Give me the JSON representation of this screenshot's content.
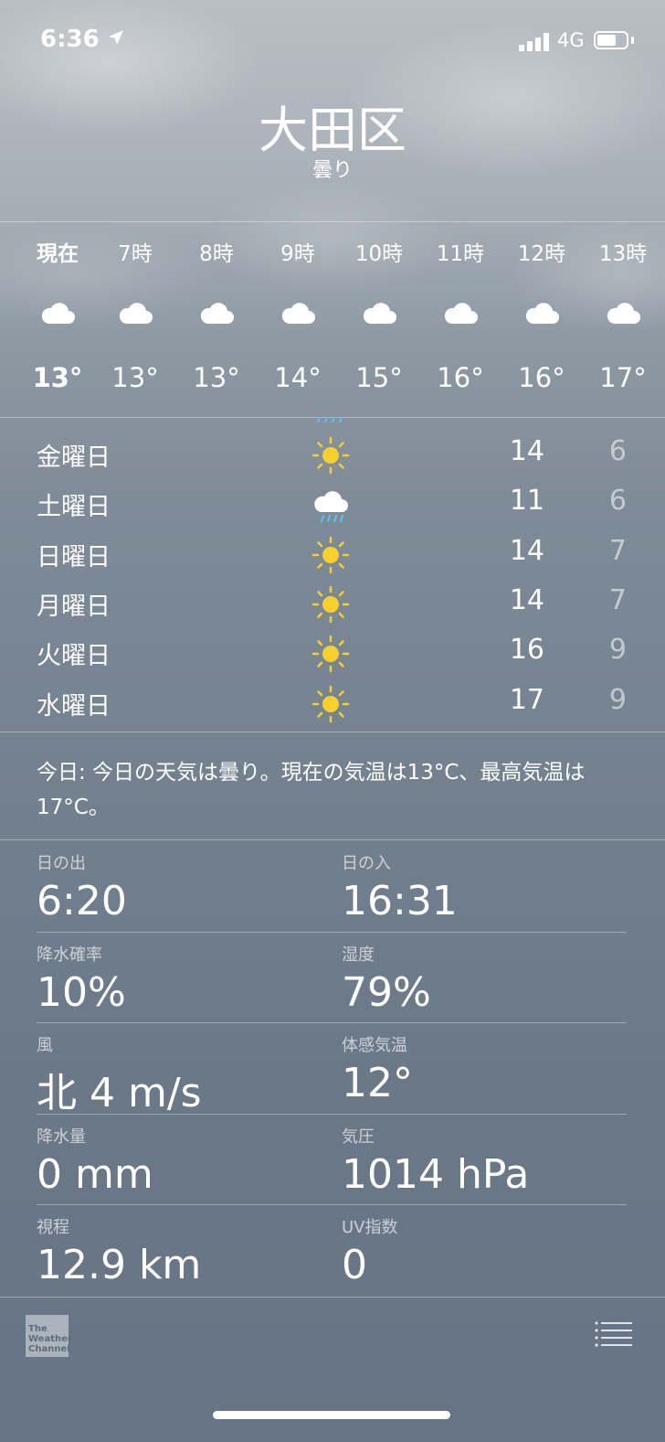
{
  "status_bar": {
    "time": "6:36",
    "network": "4G"
  },
  "location": {
    "city": "大田区",
    "condition": "曇り"
  },
  "hourly": [
    {
      "label": "現在",
      "temp": "13°",
      "icon": "cloud-icon"
    },
    {
      "label": "7時",
      "temp": "13°",
      "icon": "cloud-icon"
    },
    {
      "label": "8時",
      "temp": "13°",
      "icon": "cloud-icon"
    },
    {
      "label": "9時",
      "temp": "14°",
      "icon": "cloud-icon"
    },
    {
      "label": "10時",
      "temp": "15°",
      "icon": "cloud-icon"
    },
    {
      "label": "11時",
      "temp": "16°",
      "icon": "cloud-icon"
    },
    {
      "label": "12時",
      "temp": "16°",
      "icon": "cloud-icon"
    },
    {
      "label": "13時",
      "temp": "17°",
      "icon": "cloud-icon"
    }
  ],
  "daily": [
    {
      "day": "金曜日",
      "icon": "sun-icon",
      "high": "14",
      "low": "6"
    },
    {
      "day": "土曜日",
      "icon": "cloud-rain-icon",
      "high": "11",
      "low": "6"
    },
    {
      "day": "日曜日",
      "icon": "sun-icon",
      "high": "14",
      "low": "7"
    },
    {
      "day": "月曜日",
      "icon": "sun-icon",
      "high": "14",
      "low": "7"
    },
    {
      "day": "火曜日",
      "icon": "sun-icon",
      "high": "16",
      "low": "9"
    },
    {
      "day": "水曜日",
      "icon": "sun-icon",
      "high": "17",
      "low": "9"
    }
  ],
  "summary": "今日: 今日の天気は曇り。現在の気温は13°C、最高気温は17°C。",
  "details": [
    {
      "left": {
        "label": "日の出",
        "value": "6:20"
      },
      "right": {
        "label": "日の入",
        "value": "16:31"
      }
    },
    {
      "left": {
        "label": "降水確率",
        "value": "10%"
      },
      "right": {
        "label": "湿度",
        "value": "79%"
      }
    },
    {
      "left": {
        "label": "風",
        "value": "北 4 m/s"
      },
      "right": {
        "label": "体感気温",
        "value": "12°"
      }
    },
    {
      "left": {
        "label": "降水量",
        "value": "0 mm"
      },
      "right": {
        "label": "気圧",
        "value": "1014 hPa"
      }
    },
    {
      "left": {
        "label": "視程",
        "value": "12.9 km"
      },
      "right": {
        "label": "UV指数",
        "value": "0"
      }
    }
  ],
  "footer": {
    "logo_text": "The Weather Channel"
  },
  "colors": {
    "sun": "#f9cf2c",
    "rain": "#5fc1f2",
    "cloud": "#ffffff"
  }
}
